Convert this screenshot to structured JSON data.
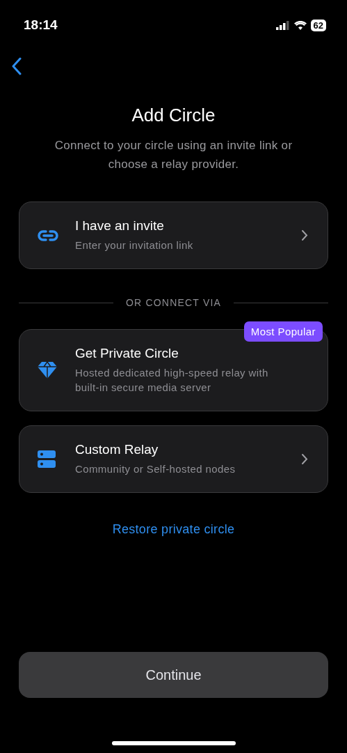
{
  "status_bar": {
    "time": "18:14",
    "battery": "62"
  },
  "title": "Add Circle",
  "subtitle": "Connect to your circle using an invite link or choose a relay provider.",
  "options": [
    {
      "kind": "invite",
      "title": "I have an invite",
      "description": "Enter your invitation link",
      "chevron": true
    },
    {
      "kind": "divider",
      "label": "OR CONNECT VIA"
    },
    {
      "kind": "private",
      "title": "Get Private Circle",
      "description": "Hosted dedicated high-speed relay with built-in secure media server",
      "chevron": false,
      "badge": "Most Popular"
    },
    {
      "kind": "relay",
      "title": "Custom Relay",
      "description": "Community or Self-hosted nodes",
      "chevron": true
    }
  ],
  "restore_link": "Restore private circle",
  "continue_button": {
    "label": "Continue",
    "disabled": true
  }
}
